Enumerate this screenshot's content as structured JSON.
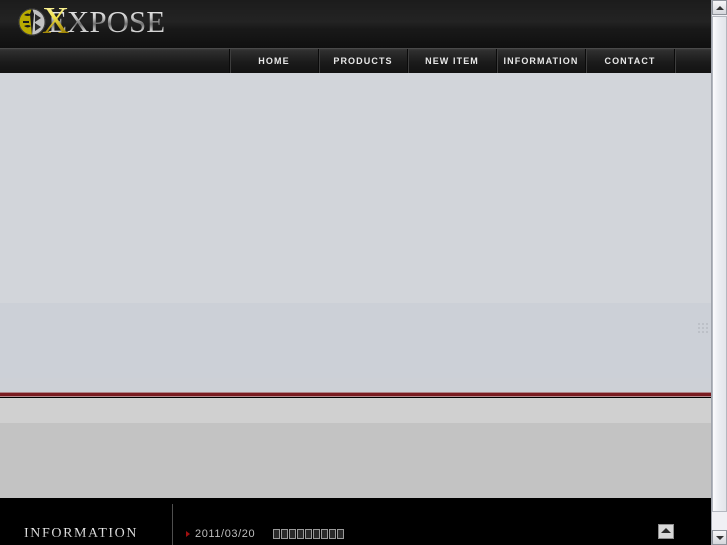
{
  "site": {
    "logo_text": "EXPOSE",
    "logo_accent_letter": "X",
    "logo_emblem_icon": "circular-crest-icon"
  },
  "nav": {
    "items": [
      {
        "label": "HOME",
        "name": "nav-item-home"
      },
      {
        "label": "PRODUCTS",
        "name": "nav-item-products"
      },
      {
        "label": "NEW ITEM",
        "name": "nav-item-new-item"
      },
      {
        "label": "INFORMATION",
        "name": "nav-item-information"
      },
      {
        "label": "CONTACT",
        "name": "nav-item-contact"
      }
    ]
  },
  "footer": {
    "section_title": "INFORMATION",
    "news": [
      {
        "date": "2011/03/20",
        "title_glyph_count": 9,
        "bullet_icon": "red-triangle-bullet-icon"
      }
    ],
    "page_top_button": {
      "label": "",
      "icon": "page-top-arrow-icon"
    }
  },
  "scrollbar": {
    "up_icon": "scroll-up-arrow-icon",
    "down_icon": "scroll-down-arrow-icon",
    "thumb": "scrollbar-thumb"
  },
  "colors": {
    "header_bg": "#1c1c1c",
    "nav_bg": "#232323",
    "main_bg": "#d2d5da",
    "divider_red": "#7a1b20",
    "lower_bg": "#c3c3c3",
    "footer_bg": "#000000",
    "accent_yellow": "#f0e14a",
    "bullet_red": "#a01010"
  }
}
